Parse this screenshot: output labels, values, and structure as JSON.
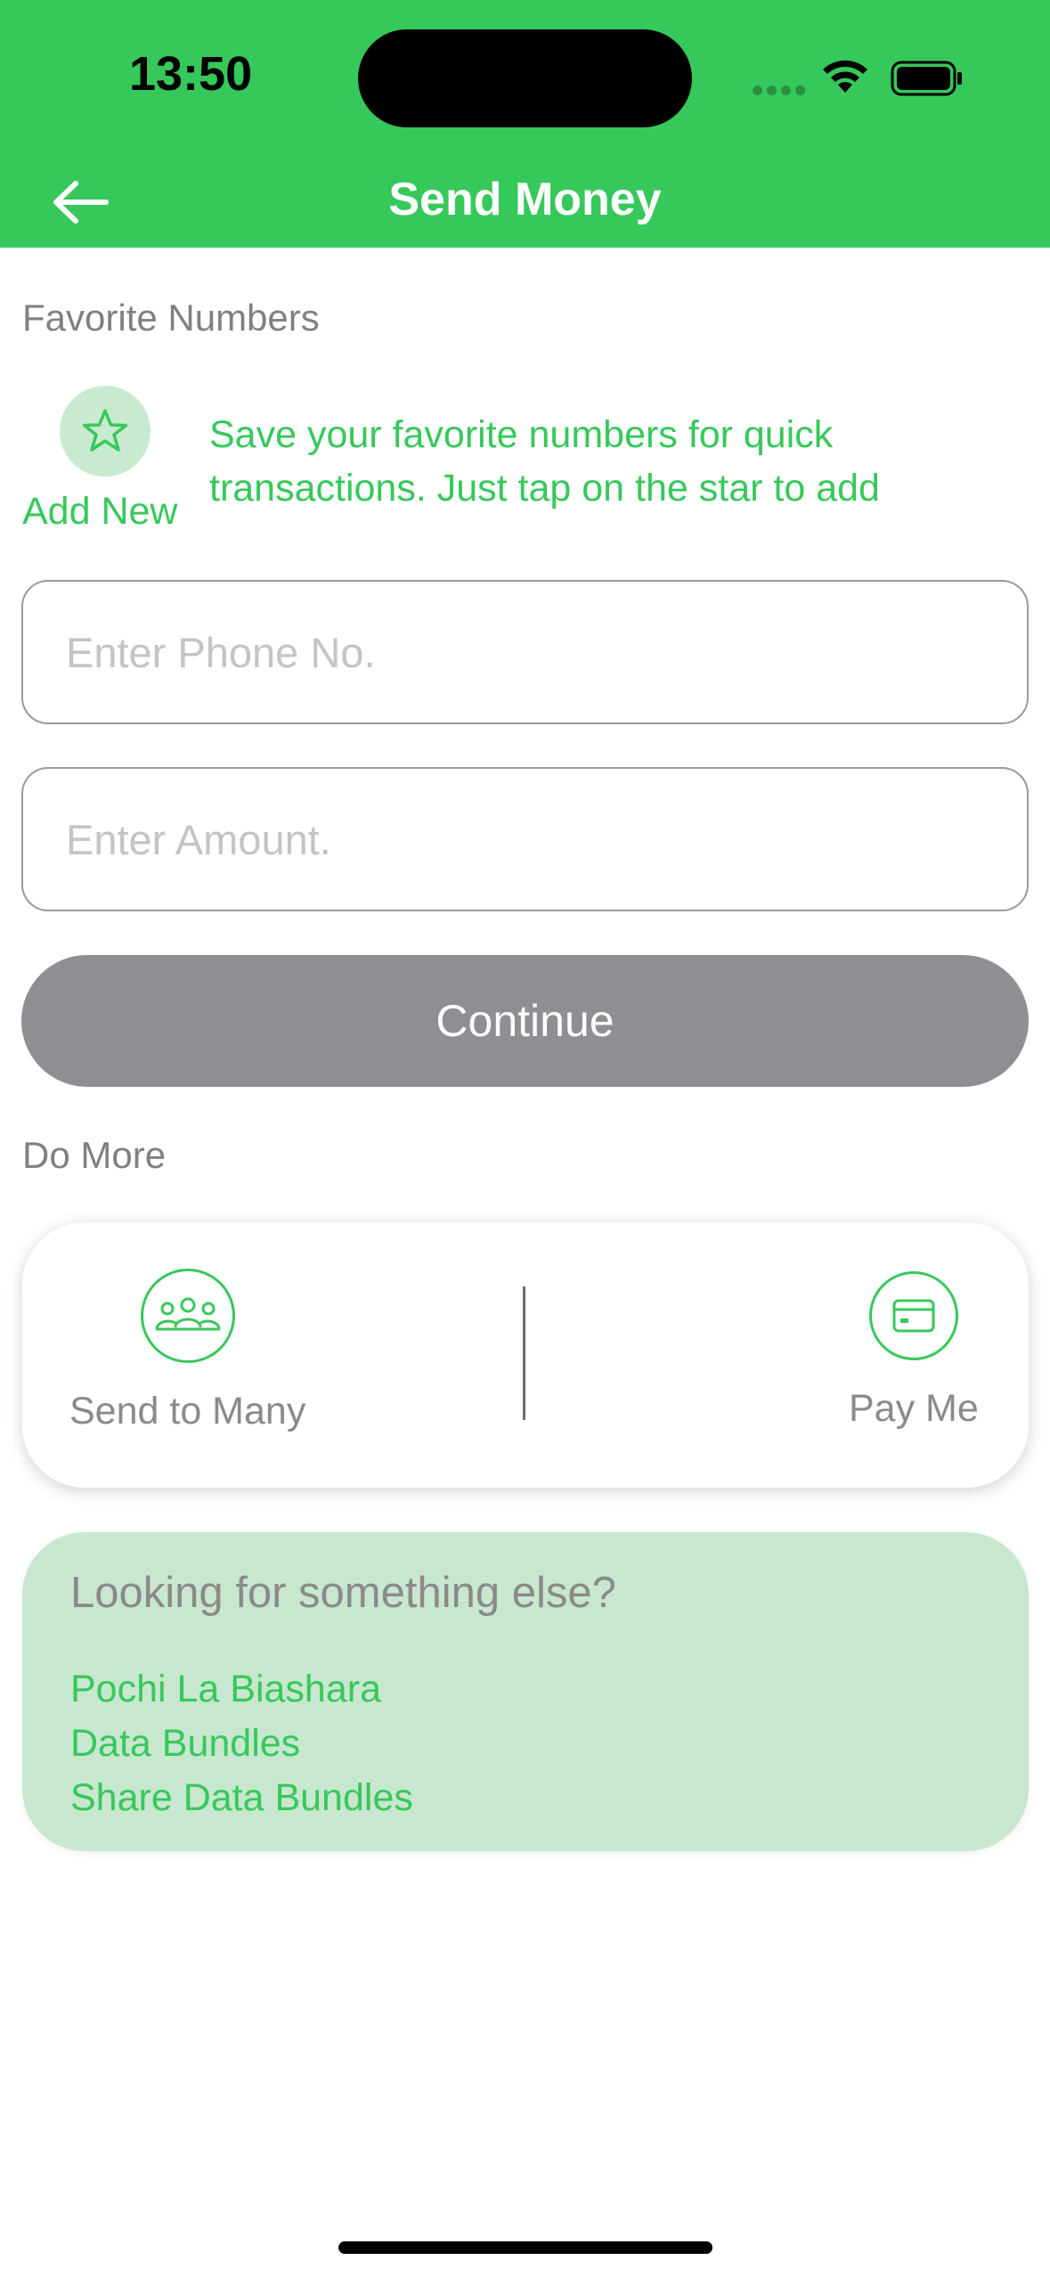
{
  "status_bar": {
    "time": "13:50"
  },
  "header": {
    "title": "Send Money",
    "back_icon": "arrow-left-icon",
    "background": "#37C85B"
  },
  "favorites": {
    "section_label": "Favorite Numbers",
    "add_label": "Add New",
    "hint": "Save your favorite numbers for quick transactions. Just tap on the star to add",
    "icon": "star-icon"
  },
  "form": {
    "phone_placeholder": "Enter Phone No.",
    "amount_placeholder": "Enter Amount.",
    "continue_label": "Continue"
  },
  "do_more": {
    "section_label": "Do More",
    "actions": [
      {
        "label": "Send to Many",
        "icon": "group-icon"
      },
      {
        "label": "Pay Me",
        "icon": "card-icon"
      }
    ]
  },
  "else_card": {
    "title": "Looking for something else?",
    "links": [
      "Pochi La Biashara",
      "Data Bundles",
      "Share Data Bundles"
    ]
  },
  "colors": {
    "accent": "#37C85B",
    "button_disabled": "#8E8E93",
    "light_green": "#C8E7CF"
  }
}
